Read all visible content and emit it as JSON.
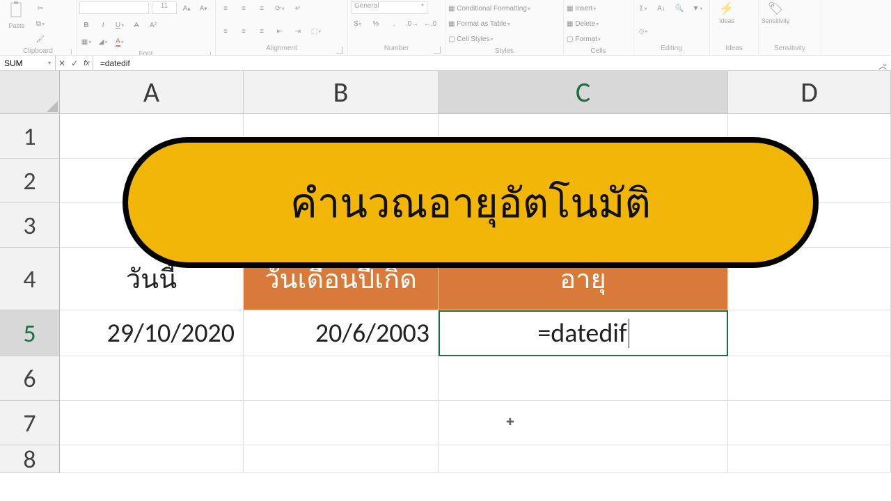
{
  "ribbon": {
    "groups": {
      "clipboard": {
        "label": "Clipboard",
        "paste": "Paste"
      },
      "font": {
        "label": "Font",
        "size": "11",
        "bold": "B",
        "italic": "I",
        "underline": "U"
      },
      "alignment": {
        "label": "Alignment"
      },
      "number": {
        "label": "Number",
        "format": "General"
      },
      "styles": {
        "label": "Styles",
        "cf": "Conditional Formatting",
        "ft": "Format as Table",
        "cs": "Cell Styles"
      },
      "cells": {
        "label": "Cells",
        "insert": "Insert",
        "delete": "Delete",
        "format": "Format"
      },
      "editing": {
        "label": "Editing"
      },
      "ideas": {
        "label": "Ideas",
        "ideas": "Ideas"
      },
      "sensitivity": {
        "label": "Sensitivity",
        "sens": "Sensitivity"
      }
    }
  },
  "name_box": "SUM",
  "formula": "=datedif",
  "columns": [
    "A",
    "B",
    "C",
    "D"
  ],
  "rows": [
    "1",
    "2",
    "3",
    "4",
    "5",
    "6",
    "7",
    "8"
  ],
  "cells": {
    "A4": "วันนี้",
    "B4": "วันเดือนปีเกิด",
    "C4": "อายุ",
    "A5": "29/10/2020",
    "B5": "20/6/2003",
    "C5": "=datedif"
  },
  "callout_title": "คำนวณอายุอัตโนมัติ"
}
